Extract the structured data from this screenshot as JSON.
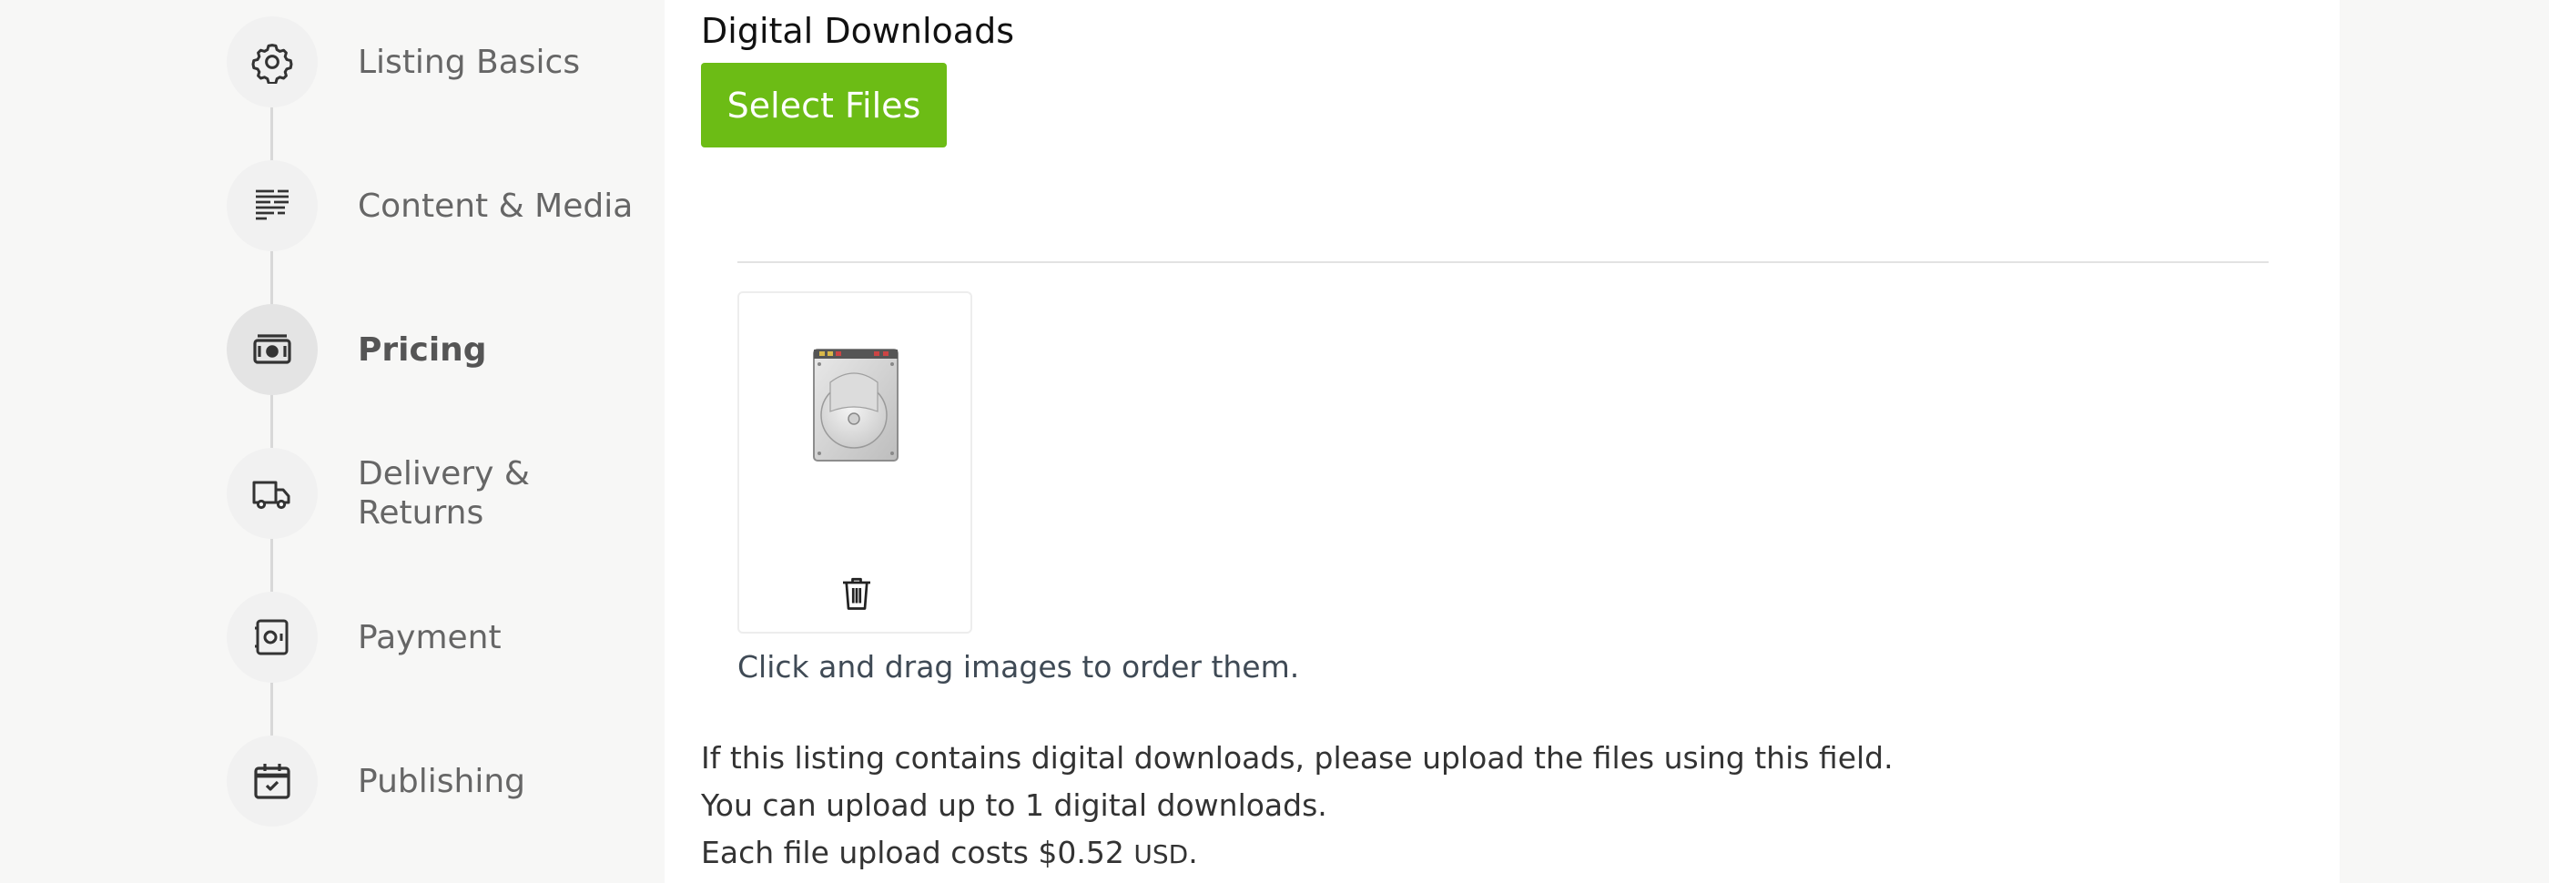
{
  "sidebar": {
    "steps": [
      {
        "label": "Listing Basics",
        "icon": "gear-icon",
        "active": false
      },
      {
        "label": "Content & Media",
        "icon": "text-lines-icon",
        "active": false
      },
      {
        "label": "Pricing",
        "icon": "money-icon",
        "active": true
      },
      {
        "label": "Delivery & Returns",
        "icon": "truck-icon",
        "active": false
      },
      {
        "label": "Payment",
        "icon": "safe-icon",
        "active": false
      },
      {
        "label": "Publishing",
        "icon": "calendar-check-icon",
        "active": false
      }
    ]
  },
  "main": {
    "section_title": "Digital Downloads",
    "select_button": "Select Files",
    "files": [
      {
        "icon": "hard-drive-icon",
        "delete_icon": "trash-icon"
      }
    ],
    "hint": "Click and drag images to order them.",
    "info_line1": "If this listing contains digital downloads, please upload the files using this field.",
    "info_line2": "You can upload up to 1 digital downloads.",
    "info_line3_prefix": "Each file upload costs $0.52",
    "info_line3_currency": "USD",
    "info_line3_suffix": "."
  },
  "colors": {
    "accent_green": "#6cbc15",
    "sidebar_bg": "#f7f7f6"
  }
}
